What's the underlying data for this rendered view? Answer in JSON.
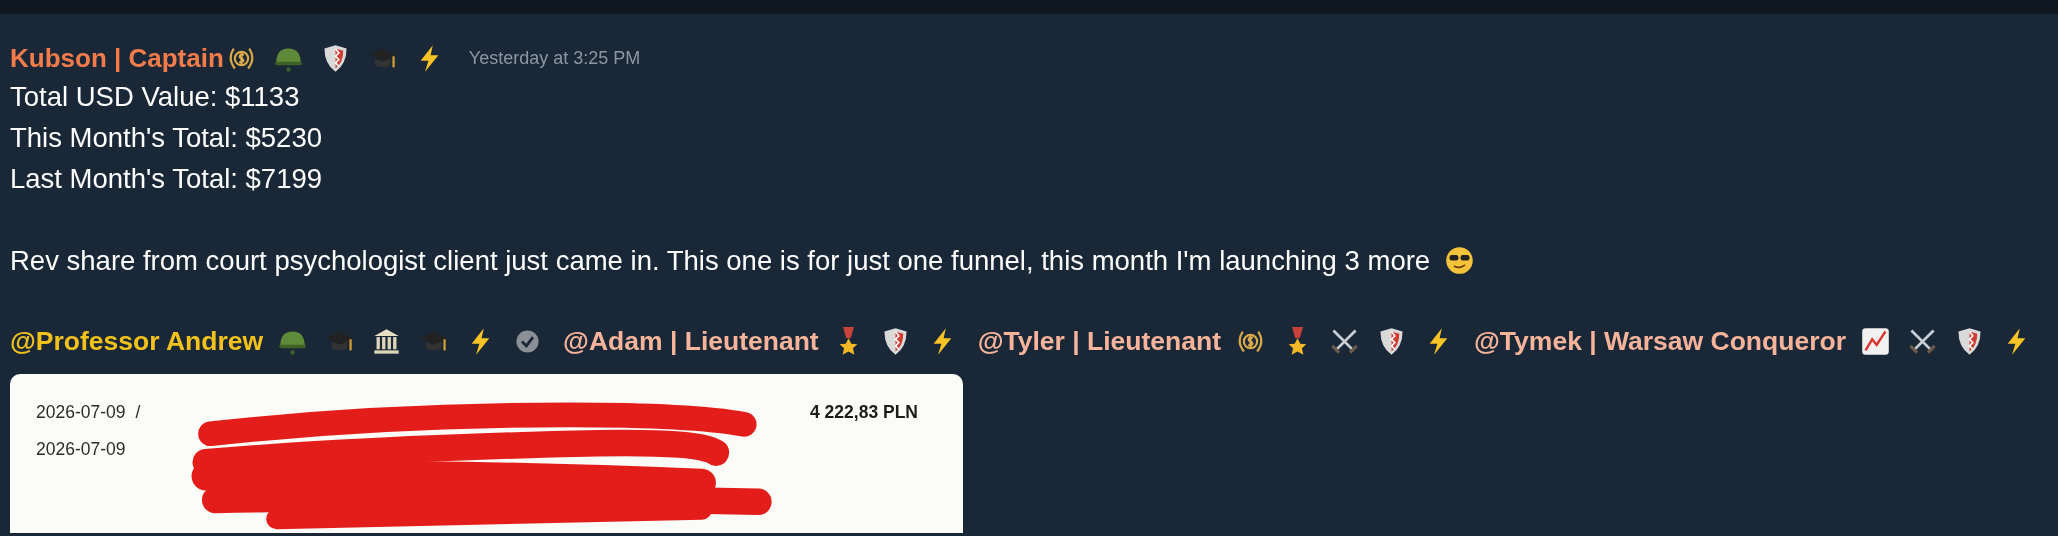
{
  "message": {
    "author": "Kubson | Captain",
    "author_badges": [
      {
        "kind": "dollar-wreath"
      },
      {
        "kind": "helmet"
      },
      {
        "kind": "shield"
      },
      {
        "kind": "grad-cap"
      },
      {
        "kind": "lightning"
      }
    ],
    "timestamp": "Yesterday at 3:25 PM",
    "stats": [
      "Total USD Value: $1133",
      "This Month's Total: $5230",
      "Last Month's Total: $7199"
    ],
    "body": "Rev share from court psychologist client just came in. This one is for just one funnel, this month I'm launching 3 more",
    "body_badge": {
      "kind": "sunglasses"
    },
    "mentions": [
      {
        "name": "@Professor Andrew",
        "color": "#f2c21b",
        "badges": [
          {
            "kind": "helmet"
          },
          {
            "kind": "grad-cap"
          },
          {
            "kind": "bank"
          },
          {
            "kind": "grad-cap"
          },
          {
            "kind": "lightning"
          },
          {
            "kind": "verified"
          }
        ]
      },
      {
        "name": "@Adam | Lieutenant",
        "color": "#f7b49a",
        "badges": [
          {
            "kind": "medal"
          },
          {
            "kind": "shield"
          },
          {
            "kind": "lightning"
          }
        ]
      },
      {
        "name": "@Tyler | Lieutenant",
        "color": "#f7b49a",
        "badges": [
          {
            "kind": "dollar-wreath"
          },
          {
            "kind": "medal"
          },
          {
            "kind": "swords"
          },
          {
            "kind": "shield"
          },
          {
            "kind": "lightning"
          }
        ]
      },
      {
        "name": "@Tymek | Warsaw Conqueror",
        "color": "#f7b49a",
        "badges": [
          {
            "kind": "chart-up"
          },
          {
            "kind": "swords"
          },
          {
            "kind": "shield"
          },
          {
            "kind": "lightning"
          }
        ]
      }
    ],
    "attachment": {
      "date_1": "2026-07-09",
      "separator": "/",
      "date_2": "2026-07-09",
      "amount": "4 222,83 PLN"
    }
  }
}
